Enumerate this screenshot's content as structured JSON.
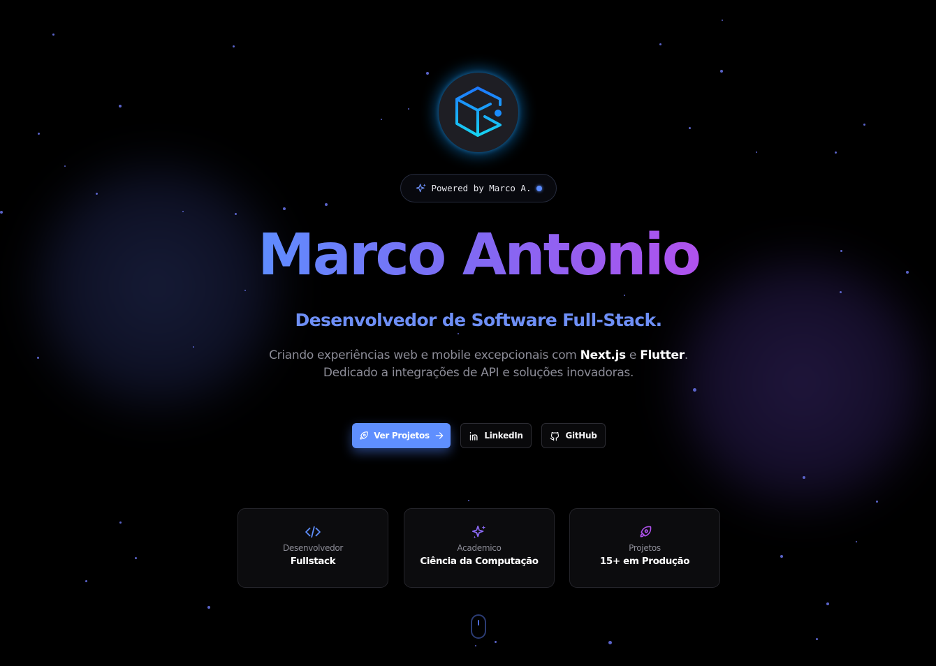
{
  "theme": {
    "background": "#000000",
    "accent_blue": "#5f8ffe",
    "accent_purple": "#b052ee",
    "logo_glow": "#0e8ce6"
  },
  "logo": {
    "icon": "cube-icon"
  },
  "badge": {
    "icon": "sparkles-icon",
    "text": "Powered by Marco A."
  },
  "hero": {
    "name": "Marco Antonio",
    "subtitle": "Desenvolvedor de Software Full-Stack.",
    "description": {
      "part1": "Criando experiências web e mobile excepcionais com ",
      "highlight1": "Next.js",
      "part2": " e ",
      "highlight2": "Flutter",
      "part3": ". Dedicado a integrações de API e soluções inovadoras."
    }
  },
  "actions": {
    "primary": {
      "label": "Ver Projetos",
      "icon": "rocket-icon",
      "trailing_icon": "arrow-right-icon"
    },
    "linkedin": {
      "label": "LinkedIn",
      "icon": "linkedin-icon"
    },
    "github": {
      "label": "GitHub",
      "icon": "github-icon"
    }
  },
  "cards": [
    {
      "icon": "code-icon",
      "label": "Desenvolvedor",
      "value": "Fullstack"
    },
    {
      "icon": "sparkles-icon",
      "label": "Academico",
      "value": "Ciência da Computação"
    },
    {
      "icon": "rocket-icon",
      "label": "Projetos",
      "value": "15+ em Produção"
    }
  ],
  "scroll_indicator": {
    "icon": "mouse-icon"
  }
}
